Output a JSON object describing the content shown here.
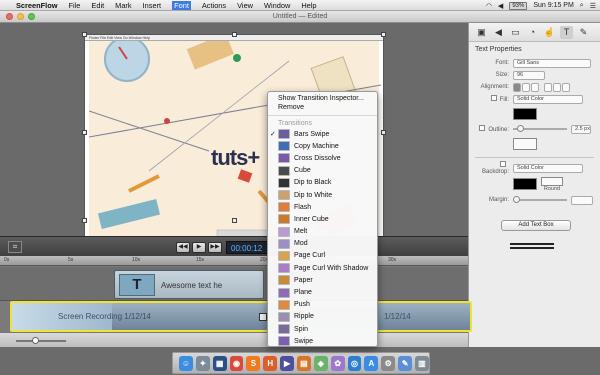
{
  "menubar": {
    "app_name": "ScreenFlow",
    "items": [
      "File",
      "Edit",
      "Mark",
      "Insert",
      "Font",
      "Actions",
      "View",
      "Window",
      "Help"
    ],
    "active_item": "Font",
    "battery": "93%",
    "clock": "Sun 9:15 PM"
  },
  "window": {
    "title": "Untitled",
    "subtitle": "— Edited"
  },
  "preview": {
    "mini_menu": "Finder  File  Edit  View  Go  Window  Help",
    "logo_text": "tuts+"
  },
  "inspector": {
    "heading": "Text Properties",
    "font_label": "Font:",
    "font_value": "Gill Sans",
    "size_label": "Size:",
    "size_value": "96",
    "alignment_label": "Alignment:",
    "fill_label": "Fill:",
    "fill_value": "Solid Color",
    "outline_label": "Outline:",
    "outline_value": "2.5 px",
    "backdrop_label": "Backdrop:",
    "backdrop_value": "Solid Color",
    "round_label": "Round",
    "margin_label": "Margin:",
    "add_text_box": "Add Text Box"
  },
  "transport": {
    "timecode": "00:00:12"
  },
  "timeline": {
    "text_clip_label": "Awesome text he",
    "screen_clip_label": "Screen Recording 1/12/14",
    "screen_clip_date_right": "1/12/14",
    "ruler_ticks": [
      "0s",
      "5s",
      "10s",
      "15s",
      "20s",
      "25s",
      "30s"
    ]
  },
  "context_menu": {
    "commands": [
      "Show Transition Inspector...",
      "Remove"
    ],
    "section_title": "Transitions",
    "selected": "Bars Swipe",
    "transitions": [
      {
        "label": "Bars Swipe",
        "color": "#6a5f9e"
      },
      {
        "label": "Copy Machine",
        "color": "#3e6fb6"
      },
      {
        "label": "Cross Dissolve",
        "color": "#7a5aa8"
      },
      {
        "label": "Cube",
        "color": "#4b4b4b"
      },
      {
        "label": "Dip to Black",
        "color": "#333333"
      },
      {
        "label": "Dip to White",
        "color": "#c9a36b"
      },
      {
        "label": "Flash",
        "color": "#e07d3a"
      },
      {
        "label": "Inner Cube",
        "color": "#c97a2a"
      },
      {
        "label": "Melt",
        "color": "#b79bd1"
      },
      {
        "label": "Mod",
        "color": "#9b8fc4"
      },
      {
        "label": "Page Curl",
        "color": "#d6a451"
      },
      {
        "label": "Page Curl With Shadow",
        "color": "#a77fc5"
      },
      {
        "label": "Paper",
        "color": "#c88b3a"
      },
      {
        "label": "Plane",
        "color": "#8e6bb5"
      },
      {
        "label": "Push",
        "color": "#e0893c"
      },
      {
        "label": "Ripple",
        "color": "#9a8fb3"
      },
      {
        "label": "Spin",
        "color": "#7a6a9a"
      },
      {
        "label": "Swipe",
        "color": "#7c5fae"
      }
    ]
  },
  "dock": {
    "apps": [
      {
        "name": "finder",
        "color": "#3b8de0",
        "glyph": "☺"
      },
      {
        "name": "launchpad",
        "color": "#7b8b9b",
        "glyph": "✦"
      },
      {
        "name": "mission-control",
        "color": "#2c4f84",
        "glyph": "▦"
      },
      {
        "name": "chrome",
        "color": "#d94a3a",
        "glyph": "◉"
      },
      {
        "name": "sublime",
        "color": "#f07a1e",
        "glyph": "S"
      },
      {
        "name": "hype",
        "color": "#e05c2b",
        "glyph": "H"
      },
      {
        "name": "screenflow",
        "color": "#4f4f9f",
        "glyph": "▶"
      },
      {
        "name": "ibooks",
        "color": "#d8752a",
        "glyph": "▤"
      },
      {
        "name": "maps",
        "color": "#6bb26a",
        "glyph": "◈"
      },
      {
        "name": "photos",
        "color": "#9a7acb",
        "glyph": "✿"
      },
      {
        "name": "safari",
        "color": "#2f7fd0",
        "glyph": "◎"
      },
      {
        "name": "appstore",
        "color": "#3a8ce6",
        "glyph": "A"
      },
      {
        "name": "settings",
        "color": "#8a8a8a",
        "glyph": "⚙"
      },
      {
        "name": "pages",
        "color": "#5a8fd8",
        "glyph": "✎"
      },
      {
        "name": "trash",
        "color": "#7f8a94",
        "glyph": "▥"
      }
    ]
  },
  "colors": {
    "selection_border": "#f0e433",
    "timecode_text": "#5ab3ff",
    "menu_highlight": "#3d7be0"
  }
}
